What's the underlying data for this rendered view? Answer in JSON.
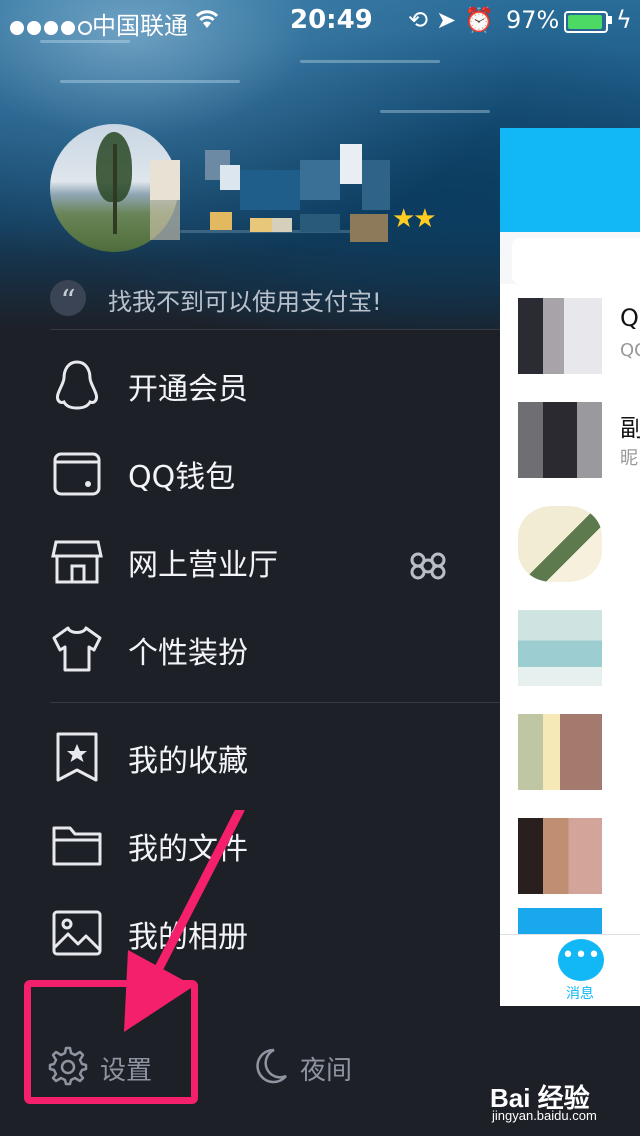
{
  "status_bar": {
    "carrier": "中国联通",
    "time": "20:49",
    "battery": "97%",
    "signal_dots_filled": 4,
    "signal_dots_total": 5,
    "battery_level": 0.97,
    "icons": [
      "wifi-icon",
      "orientation-lock-icon",
      "location-icon",
      "alarm-icon",
      "charging-icon"
    ]
  },
  "profile": {
    "stars": "★★",
    "signature": "找我不到可以使用支付宝!",
    "quote_mark": "“"
  },
  "menu": {
    "group1": [
      {
        "label": "开通会员",
        "icon": "penguin-icon"
      },
      {
        "label": "QQ钱包",
        "icon": "wallet-icon"
      },
      {
        "label": "网上营业厅",
        "icon": "store-icon"
      },
      {
        "label": "个性装扮",
        "icon": "tshirt-icon"
      }
    ],
    "group2": [
      {
        "label": "我的收藏",
        "icon": "bookmark-star-icon"
      },
      {
        "label": "我的文件",
        "icon": "folder-icon"
      },
      {
        "label": "我的相册",
        "icon": "photo-icon"
      }
    ]
  },
  "bottom": {
    "settings": "设置",
    "night": "夜间"
  },
  "panel": {
    "rows": [
      {
        "title": "QQ",
        "sub": "QQ"
      },
      {
        "title": "副",
        "sub": "昵"
      },
      {
        "title": "",
        "sub": ""
      },
      {
        "title": "",
        "sub": ""
      },
      {
        "title": "",
        "sub": ""
      },
      {
        "title": "",
        "sub": ""
      },
      {
        "title": "",
        "sub": ""
      }
    ],
    "tab_label": "消息",
    "tab_icon_text": "•••"
  },
  "watermark": {
    "brand": "Bai  经验",
    "url": "jingyan.baidu.com"
  },
  "colors": {
    "sidebar_bg": "#1d2027",
    "accent_blue": "#12b7f5",
    "highlight": "#f4206b",
    "star": "#ffcc22"
  }
}
